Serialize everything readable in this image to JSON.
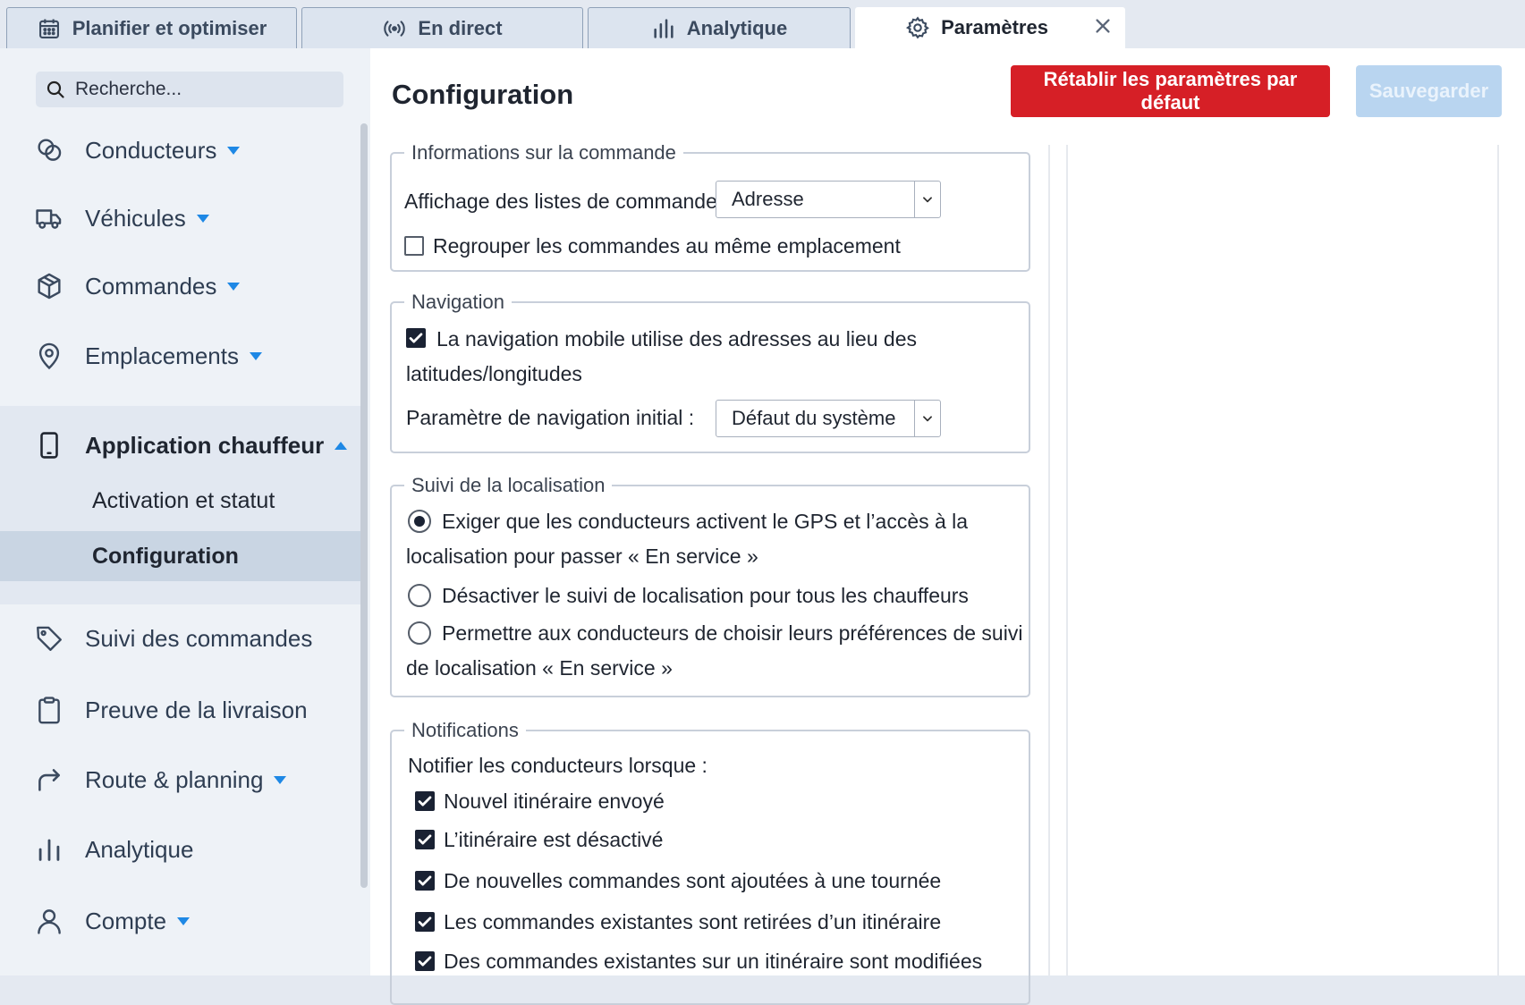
{
  "tabs": [
    {
      "label": "Planifier et optimiser",
      "icon": "calendar-icon"
    },
    {
      "label": "En direct",
      "icon": "broadcast-icon"
    },
    {
      "label": "Analytique",
      "icon": "bar-chart-icon"
    },
    {
      "label": "Paramètres",
      "icon": "gear-icon",
      "active": true
    }
  ],
  "sidebar": {
    "search_placeholder": "Recherche...",
    "items": [
      {
        "label": "Conducteurs",
        "icon": "drivers-icon"
      },
      {
        "label": "Véhicules",
        "icon": "truck-icon"
      },
      {
        "label": "Commandes",
        "icon": "box-icon"
      },
      {
        "label": "Emplacements",
        "icon": "location-pin-icon"
      },
      {
        "label": "Application chauffeur",
        "icon": "mobile-phone-icon",
        "expanded": true
      },
      {
        "label": "Suivi des commandes",
        "icon": "tag-icon"
      },
      {
        "label": "Preuve de la livraison",
        "icon": "clipboard-icon"
      },
      {
        "label": "Route & planning",
        "icon": "route-arrow-icon"
      },
      {
        "label": "Analytique",
        "icon": "bar-chart-icon"
      },
      {
        "label": "Compte",
        "icon": "user-icon"
      }
    ],
    "subitems": [
      {
        "label": "Activation et statut"
      },
      {
        "label": "Configuration",
        "selected": true
      }
    ]
  },
  "main": {
    "title": "Configuration",
    "reset_label": "Rétablir les paramètres par défaut",
    "save_label": "Sauvegarder",
    "accent_color": "#d61f26",
    "sections": {
      "orders": {
        "legend": "Informations sur la commande",
        "list_display_label": "Affichage des listes de commandes :",
        "list_display_value": "Adresse",
        "group_label": "Regrouper les commandes au même emplacement",
        "group_checked": false
      },
      "navigation": {
        "legend": "Navigation",
        "mobile_label_line1": "La navigation mobile utilise des adresses au lieu des",
        "mobile_label_line2": "latitudes/longitudes",
        "mobile_checked": true,
        "initial_label": "Paramètre de navigation initial :",
        "initial_value": "Défaut du système"
      },
      "tracking": {
        "legend": "Suivi de la localisation",
        "opt1_line1": "Exiger que les conducteurs activent le GPS et l’accès à la",
        "opt1_line2": "localisation pour passer « En service »",
        "opt2": "Désactiver le suivi de localisation pour tous les chauffeurs",
        "opt3_line1": "Permettre aux conducteurs de choisir leurs préférences de suivi",
        "opt3_line2": "de localisation « En service »",
        "selected": 1
      },
      "notifications": {
        "legend": "Notifications",
        "intro": "Notifier les conducteurs lorsque :",
        "items": [
          "Nouvel itinéraire envoyé",
          "L’itinéraire est désactivé",
          "De nouvelles commandes sont ajoutées à une tournée",
          "Les commandes existantes sont retirées d’un itinéraire",
          "Des commandes existantes sur un itinéraire sont modifiées"
        ]
      }
    }
  }
}
